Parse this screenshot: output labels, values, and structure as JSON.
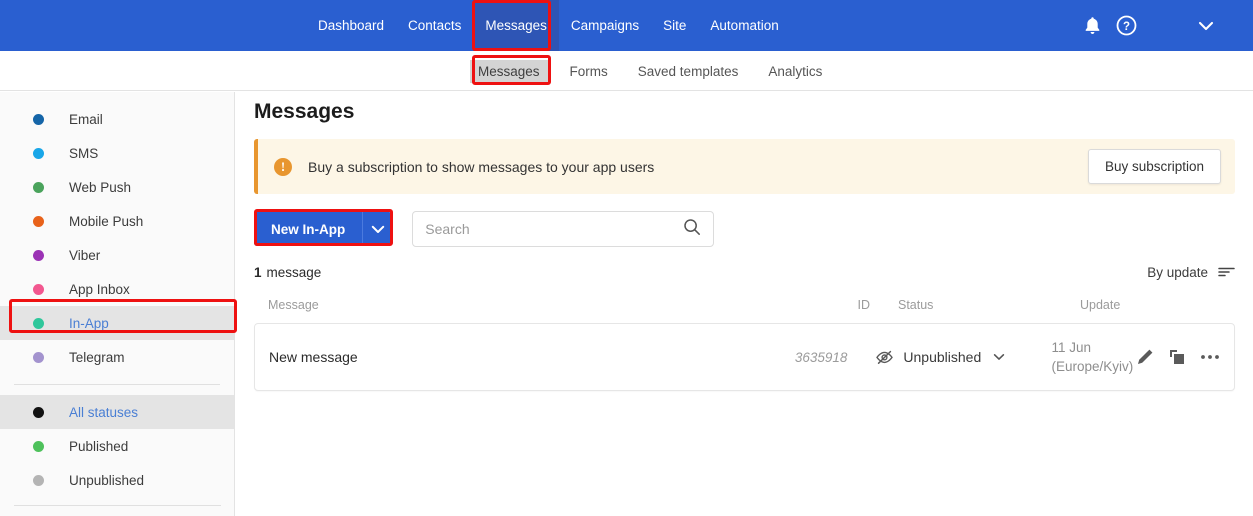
{
  "topnav": {
    "items": [
      {
        "label": "Dashboard",
        "active": false
      },
      {
        "label": "Contacts",
        "active": false
      },
      {
        "label": "Messages",
        "active": true
      },
      {
        "label": "Campaigns",
        "active": false
      },
      {
        "label": "Site",
        "active": false
      },
      {
        "label": "Automation",
        "active": false
      }
    ],
    "icons": {
      "bell": "bell-icon",
      "help": "help-icon",
      "account_caret": "chevron-down-icon"
    }
  },
  "subnav": {
    "items": [
      {
        "label": "Messages",
        "active": true
      },
      {
        "label": "Forms",
        "active": false
      },
      {
        "label": "Saved templates",
        "active": false
      },
      {
        "label": "Analytics",
        "active": false
      }
    ]
  },
  "sidebar": {
    "channels": [
      {
        "label": "Email",
        "color": "#1565a8",
        "selected": false
      },
      {
        "label": "SMS",
        "color": "#19a6e8",
        "selected": false
      },
      {
        "label": "Web Push",
        "color": "#4aa35c",
        "selected": false
      },
      {
        "label": "Mobile Push",
        "color": "#e8621a",
        "selected": false
      },
      {
        "label": "Viber",
        "color": "#9b32b5",
        "selected": false
      },
      {
        "label": "App Inbox",
        "color": "#f2578f",
        "selected": false
      },
      {
        "label": "In-App",
        "color": "#2fc79b",
        "selected": true
      },
      {
        "label": "Telegram",
        "color": "#a393ce",
        "selected": false
      }
    ],
    "statuses": [
      {
        "label": "All statuses",
        "color": "#111111",
        "selected": true
      },
      {
        "label": "Published",
        "color": "#4ec15b",
        "selected": false
      },
      {
        "label": "Unpublished",
        "color": "#b4b4b4",
        "selected": false
      }
    ]
  },
  "main": {
    "title": "Messages",
    "banner": {
      "icon": "alert-icon",
      "text": "Buy a subscription to show messages to your app users",
      "button_label": "Buy subscription",
      "accent_color": "#e8962f"
    },
    "toolbar": {
      "new_button_label": "New In-App",
      "new_button_caret": "chevron-down-icon",
      "search_placeholder": "Search",
      "search_value": "",
      "search_icon": "search-icon"
    },
    "count": {
      "number": "1",
      "label": "message"
    },
    "sort": {
      "label": "By update",
      "icon": "sort-icon"
    },
    "table": {
      "columns": [
        "Message",
        "ID",
        "Status",
        "Update"
      ],
      "rows": [
        {
          "message": "New message",
          "id": "3635918",
          "status": "Unpublished",
          "status_icon": "eye-slash-icon",
          "status_caret": "chevron-down-icon",
          "update_date": "11 Jun",
          "update_tz": "(Europe/Kyiv)",
          "actions": [
            "edit-icon",
            "duplicate-icon",
            "more-icon"
          ]
        }
      ]
    }
  },
  "annotations": {
    "highlight_color": "#ee1111",
    "boxes": [
      "messages-topnav",
      "messages-subnav",
      "in-app-sidebar",
      "new-in-app-button"
    ]
  }
}
